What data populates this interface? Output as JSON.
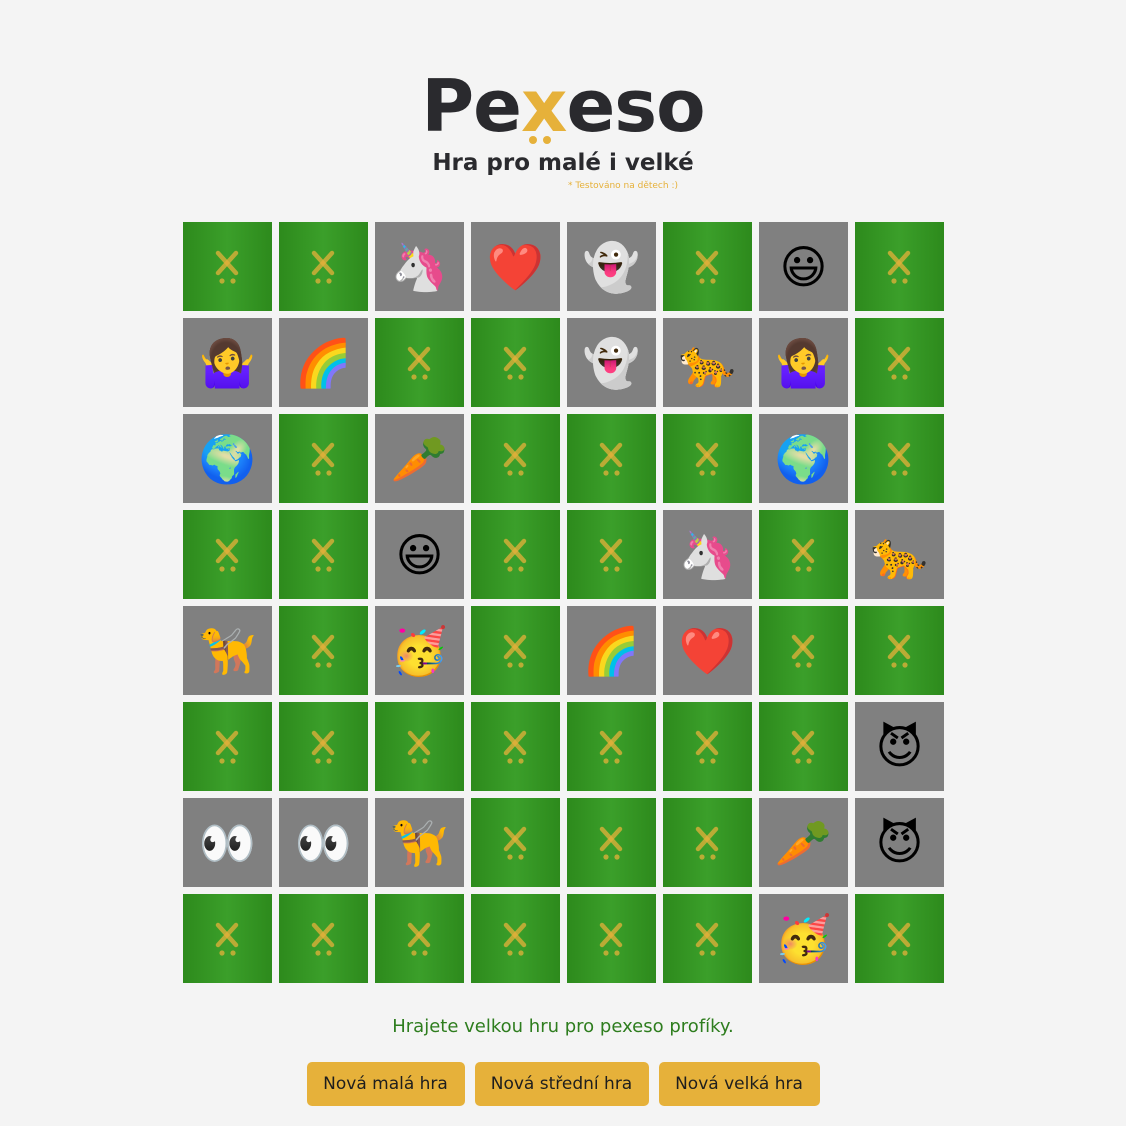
{
  "header": {
    "logo_prefix": "Pe",
    "logo_x": "x",
    "logo_suffix": "eso",
    "subtitle": "Hra pro malé i velké",
    "note": "* Testováno na dětech :)"
  },
  "colors": {
    "accent": "#e6b13a",
    "card_back": "#3b9f2a",
    "card_face": "#808080",
    "message": "#2e7d1e",
    "text": "#2a2a2e"
  },
  "board": {
    "rows": 8,
    "cols": 8,
    "cards": [
      {
        "state": "hidden"
      },
      {
        "state": "hidden"
      },
      {
        "state": "revealed",
        "emoji": "🦄",
        "icon": "unicorn"
      },
      {
        "state": "revealed",
        "emoji": "❤️",
        "icon": "red-heart"
      },
      {
        "state": "revealed",
        "emoji": "👻",
        "icon": "ghost"
      },
      {
        "state": "hidden"
      },
      {
        "state": "revealed",
        "emoji": "😃",
        "icon": "smiley"
      },
      {
        "state": "hidden"
      },
      {
        "state": "revealed",
        "emoji": "🤷‍♀️",
        "icon": "woman-shrugging"
      },
      {
        "state": "revealed",
        "emoji": "🌈",
        "icon": "rainbow"
      },
      {
        "state": "hidden"
      },
      {
        "state": "hidden"
      },
      {
        "state": "revealed",
        "emoji": "👻",
        "icon": "ghost"
      },
      {
        "state": "revealed",
        "emoji": "🐆",
        "icon": "leopard"
      },
      {
        "state": "revealed",
        "emoji": "🤷‍♀️",
        "icon": "woman-shrugging"
      },
      {
        "state": "hidden"
      },
      {
        "state": "revealed",
        "emoji": "🌍",
        "icon": "globe"
      },
      {
        "state": "hidden"
      },
      {
        "state": "revealed",
        "emoji": "🥕",
        "icon": "carrot"
      },
      {
        "state": "hidden"
      },
      {
        "state": "hidden"
      },
      {
        "state": "hidden"
      },
      {
        "state": "revealed",
        "emoji": "🌍",
        "icon": "globe"
      },
      {
        "state": "hidden"
      },
      {
        "state": "hidden"
      },
      {
        "state": "hidden"
      },
      {
        "state": "revealed",
        "emoji": "😃",
        "icon": "smiley"
      },
      {
        "state": "hidden"
      },
      {
        "state": "hidden"
      },
      {
        "state": "revealed",
        "emoji": "🦄",
        "icon": "unicorn"
      },
      {
        "state": "hidden"
      },
      {
        "state": "revealed",
        "emoji": "🐆",
        "icon": "leopard"
      },
      {
        "state": "revealed",
        "emoji": "🦮",
        "icon": "guide-dog"
      },
      {
        "state": "hidden"
      },
      {
        "state": "revealed",
        "emoji": "🥳",
        "icon": "partying-face"
      },
      {
        "state": "hidden"
      },
      {
        "state": "revealed",
        "emoji": "🌈",
        "icon": "rainbow"
      },
      {
        "state": "revealed",
        "emoji": "❤️",
        "icon": "red-heart"
      },
      {
        "state": "hidden"
      },
      {
        "state": "hidden"
      },
      {
        "state": "hidden"
      },
      {
        "state": "hidden"
      },
      {
        "state": "hidden"
      },
      {
        "state": "hidden"
      },
      {
        "state": "hidden"
      },
      {
        "state": "hidden"
      },
      {
        "state": "hidden"
      },
      {
        "state": "revealed",
        "emoji": "😈",
        "icon": "smiling-devil"
      },
      {
        "state": "revealed",
        "emoji": "👀",
        "icon": "eyes"
      },
      {
        "state": "revealed",
        "emoji": "👀",
        "icon": "eyes"
      },
      {
        "state": "revealed",
        "emoji": "🦮",
        "icon": "guide-dog"
      },
      {
        "state": "hidden"
      },
      {
        "state": "hidden"
      },
      {
        "state": "hidden"
      },
      {
        "state": "revealed",
        "emoji": "🥕",
        "icon": "carrot"
      },
      {
        "state": "revealed",
        "emoji": "😈",
        "icon": "smiling-devil"
      },
      {
        "state": "hidden"
      },
      {
        "state": "hidden"
      },
      {
        "state": "hidden"
      },
      {
        "state": "hidden"
      },
      {
        "state": "hidden"
      },
      {
        "state": "hidden"
      },
      {
        "state": "revealed",
        "emoji": "🥳",
        "icon": "partying-face"
      },
      {
        "state": "hidden"
      }
    ]
  },
  "message": "Hrajete velkou hru pro pexeso profíky.",
  "buttons": {
    "small": "Nová malá hra",
    "medium": "Nová střední hra",
    "large": "Nová velká hra"
  }
}
